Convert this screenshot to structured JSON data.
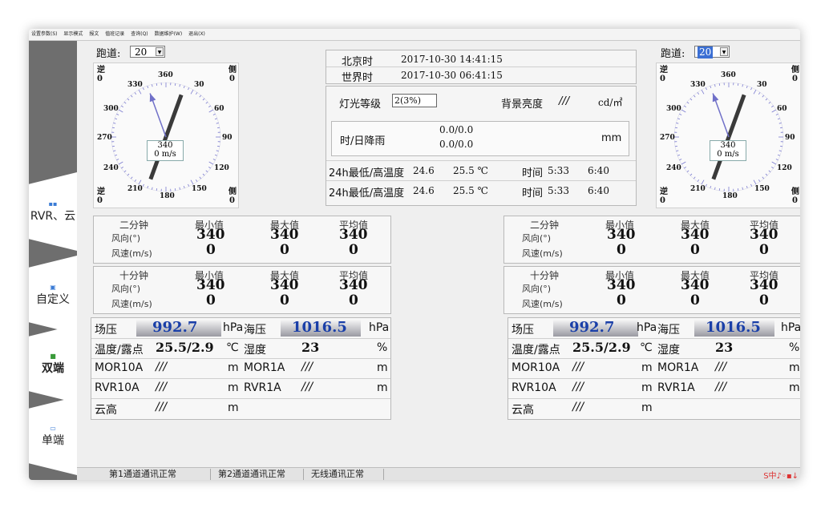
{
  "menu": [
    "设置参数(S)",
    "显示模式",
    "报文",
    "值班记录",
    "查询(Q)",
    "数据维护(W)",
    "退出(X)"
  ],
  "sidebar": {
    "tabs": [
      {
        "label": "RVR、云",
        "icon": "rvr-icon"
      },
      {
        "label": "自定义",
        "icon": "custom-icon"
      },
      {
        "label": "双端",
        "icon": "dual-icon",
        "active": true
      },
      {
        "label": "单端",
        "icon": "single-icon"
      }
    ]
  },
  "left": {
    "runway_label": "跑道:",
    "runway_value": "20",
    "dial": {
      "corner_tl": "逆",
      "corner_tl_val": "0",
      "corner_tr": "侧",
      "corner_tr_val": "0",
      "corner_bl": "逆",
      "corner_bl_val": "0",
      "corner_br": "侧",
      "corner_br_val": "0",
      "labels": {
        "d0": "360",
        "d30": "30",
        "d60": "60",
        "d90": "90",
        "d120": "120",
        "d150": "150",
        "d180": "180",
        "d210": "210",
        "d240": "240",
        "d270": "270",
        "d300": "300",
        "d330": "330"
      },
      "center_dir": "340",
      "center_speed": "0  m/s",
      "arrow_deg": 340
    }
  },
  "right": {
    "runway_label": "跑道:",
    "runway_value": "20",
    "dial": {
      "corner_tl": "逆",
      "corner_tl_val": "0",
      "corner_tr": "侧",
      "corner_tr_val": "0",
      "corner_bl": "逆",
      "corner_bl_val": "0",
      "corner_br": "侧",
      "corner_br_val": "0",
      "labels": {
        "d0": "360",
        "d30": "30",
        "d60": "60",
        "d90": "90",
        "d120": "120",
        "d150": "150",
        "d180": "180",
        "d210": "210",
        "d240": "240",
        "d270": "270",
        "d300": "300",
        "d330": "330"
      },
      "center_dir": "340",
      "center_speed": "0  m/s",
      "arrow_deg": 340
    }
  },
  "info": {
    "beijing_label": "北京时",
    "beijing_time": "2017-10-30 14:41:15",
    "utc_label": "世界时",
    "utc_time": "2017-10-30 06:41:15",
    "light_label": "灯光等级",
    "light_value": "2(3%)",
    "bg_label": "背景亮度",
    "bg_value": "///",
    "bg_unit": "cd/㎡",
    "rain_label": "时/日降雨",
    "rain_line1": "0.0/0.0",
    "rain_line2": "0.0/0.0",
    "rain_unit": "mm",
    "temp1_label": "24h最低/高温度",
    "temp1_low": "24.6",
    "temp1_high": "25.5 ℃",
    "temp1_time_label": "时间",
    "temp1_time_low": "5:33",
    "temp1_time_high": "6:40",
    "temp2_label": "24h最低/高温度",
    "temp2_low": "24.6",
    "temp2_high": "25.5 ℃",
    "temp2_time_label": "时间",
    "temp2_time_low": "5:33",
    "temp2_time_high": "6:40"
  },
  "wind_left": {
    "two_min": {
      "title": "二分钟",
      "dir_label": "风向(°)",
      "speed_label": "风速(m/s)",
      "min_label": "最小值",
      "max_label": "最大值",
      "avg_label": "平均值",
      "dir_min": "340",
      "dir_max": "340",
      "dir_avg": "340",
      "spd_min": "0",
      "spd_max": "0",
      "spd_avg": "0"
    },
    "ten_min": {
      "title": "十分钟",
      "dir_label": "风向(°)",
      "speed_label": "风速(m/s)",
      "min_label": "最小值",
      "max_label": "最大值",
      "avg_label": "平均值",
      "dir_min": "340",
      "dir_max": "340",
      "dir_avg": "340",
      "spd_min": "0",
      "spd_max": "0",
      "spd_avg": "0"
    }
  },
  "wind_right": {
    "two_min": {
      "title": "二分钟",
      "dir_label": "风向(°)",
      "speed_label": "风速(m/s)",
      "min_label": "最小值",
      "max_label": "最大值",
      "avg_label": "平均值",
      "dir_min": "340",
      "dir_max": "340",
      "dir_avg": "340",
      "spd_min": "0",
      "spd_max": "0",
      "spd_avg": "0"
    },
    "ten_min": {
      "title": "十分钟",
      "dir_label": "风向(°)",
      "speed_label": "风速(m/s)",
      "min_label": "最小值",
      "max_label": "最大值",
      "avg_label": "平均值",
      "dir_min": "340",
      "dir_max": "340",
      "dir_avg": "340",
      "spd_min": "0",
      "spd_max": "0",
      "spd_avg": "0"
    }
  },
  "sensors_left": {
    "qfe_label": "场压",
    "qfe_value": "992.7",
    "qfe_unit": "hPa",
    "qnh_label": "海压",
    "qnh_value": "1016.5",
    "qnh_unit": "hPa",
    "td_label": "温度/露点",
    "td_value": "25.5/2.9",
    "td_unit": "℃",
    "rh_label": "湿度",
    "rh_value": "23",
    "rh_unit": "%",
    "mor10_label": "MOR10A",
    "mor10_value": "///",
    "mor10_unit": "m",
    "mor1_label": "MOR1A",
    "mor1_value": "///",
    "mor1_unit": "m",
    "rvr10_label": "RVR10A",
    "rvr10_value": "///",
    "rvr10_unit": "m",
    "rvr1_label": "RVR1A",
    "rvr1_value": "///",
    "rvr1_unit": "m",
    "cloud_label": "云高",
    "cloud_value": "///",
    "cloud_unit": "m"
  },
  "sensors_right": {
    "qfe_label": "场压",
    "qfe_value": "992.7",
    "qfe_unit": "hPa",
    "qnh_label": "海压",
    "qnh_value": "1016.5",
    "qnh_unit": "hPa",
    "td_label": "温度/露点",
    "td_value": "25.5/2.9",
    "td_unit": "℃",
    "rh_label": "湿度",
    "rh_value": "23",
    "rh_unit": "%",
    "mor10_label": "MOR10A",
    "mor10_value": "///",
    "mor10_unit": "m",
    "mor1_label": "MOR1A",
    "mor1_value": "///",
    "mor1_unit": "m",
    "rvr10_label": "RVR10A",
    "rvr10_value": "///",
    "rvr10_unit": "m",
    "rvr1_label": "RVR1A",
    "rvr1_value": "///",
    "rvr1_unit": "m",
    "cloud_label": "云高",
    "cloud_value": "///",
    "cloud_unit": "m"
  },
  "status": {
    "ch1": "第1通道通讯正常",
    "ch2": "第2通道通讯正常",
    "wireless": "无线通讯正常",
    "tray_icon": "ime-tray-icon"
  }
}
